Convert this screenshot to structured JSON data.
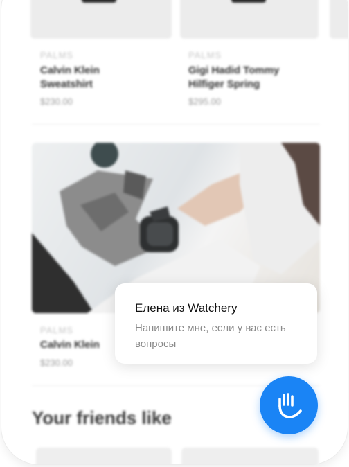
{
  "products_top": [
    {
      "brand": "PALMS",
      "name_line1": "Calvin Klein",
      "name_line2": "Sweatshirt",
      "price": "$230.00"
    },
    {
      "brand": "PALMS",
      "name_line1": "Gigi Hadid Tommy",
      "name_line2": "Hilfiger Spring",
      "price": "$295.00"
    }
  ],
  "featured_product": {
    "brand": "PALMS",
    "name": "Calvin Klein",
    "price": "$230.00"
  },
  "section": {
    "title": "Your friends like"
  },
  "chat": {
    "name": "Елена из Watchery",
    "message": "Напишите мне, если у вас есть вопросы",
    "button_icon": "hand-wave-icon",
    "accent_color": "#1a84f5"
  }
}
